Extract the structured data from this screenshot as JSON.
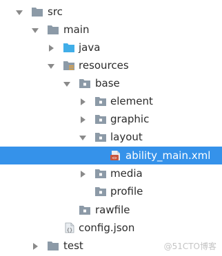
{
  "project_tree": {
    "items": [
      {
        "label": "src",
        "kind": "folder",
        "expanded": true
      },
      {
        "label": "main",
        "kind": "folder",
        "expanded": true
      },
      {
        "label": "java",
        "kind": "java-source-folder",
        "expanded": false
      },
      {
        "label": "resources",
        "kind": "resources-folder",
        "expanded": true
      },
      {
        "label": "base",
        "kind": "folder",
        "expanded": true
      },
      {
        "label": "element",
        "kind": "folder",
        "expanded": false
      },
      {
        "label": "graphic",
        "kind": "folder",
        "expanded": false
      },
      {
        "label": "layout",
        "kind": "folder",
        "expanded": true
      },
      {
        "label": "ability_main.xml",
        "kind": "xml-file",
        "selected": true
      },
      {
        "label": "media",
        "kind": "folder",
        "expanded": false
      },
      {
        "label": "profile",
        "kind": "folder"
      },
      {
        "label": "rawfile",
        "kind": "folder"
      },
      {
        "label": "config.json",
        "kind": "json-file"
      },
      {
        "label": "test",
        "kind": "folder",
        "expanded": false
      }
    ]
  },
  "watermark": "@51CTO博客",
  "colors": {
    "selection": "#3592ea",
    "folder": "#8c9aa7",
    "java_folder": "#41aee8",
    "xml_badge": "#c8553d",
    "arrow": "#8a8a8a"
  }
}
